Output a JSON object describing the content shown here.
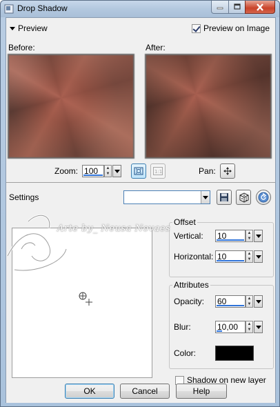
{
  "window": {
    "title": "Drop Shadow",
    "background_text": ""
  },
  "preview": {
    "toggle_label": "Preview",
    "preview_on_image_label": "Preview on Image",
    "preview_on_image_checked": true,
    "before_label": "Before:",
    "after_label": "After:",
    "zoom_label": "Zoom:",
    "zoom_value": "100",
    "pan_label": "Pan:"
  },
  "settings": {
    "label": "Settings",
    "preset_value": ""
  },
  "offset": {
    "title": "Offset",
    "vertical_label": "Vertical:",
    "vertical_value": "10",
    "horizontal_label": "Horizontal:",
    "horizontal_value": "10"
  },
  "attributes": {
    "title": "Attributes",
    "opacity_label": "Opacity:",
    "opacity_value": "60",
    "blur_label": "Blur:",
    "blur_value": "10,00",
    "color_label": "Color:",
    "color_value": "#000000"
  },
  "shadow_new_layer": {
    "label": "Shadow on new layer",
    "checked": false
  },
  "buttons": {
    "ok": "OK",
    "cancel": "Cancel",
    "help": "Help"
  },
  "watermark_text": "Arte by_ Neusa Novaes",
  "colors": {
    "title_bar": "#b3c8df",
    "dialog_bg": "#f0f0f0",
    "accent": "#2f73d9",
    "close_button": "#c9432a"
  }
}
